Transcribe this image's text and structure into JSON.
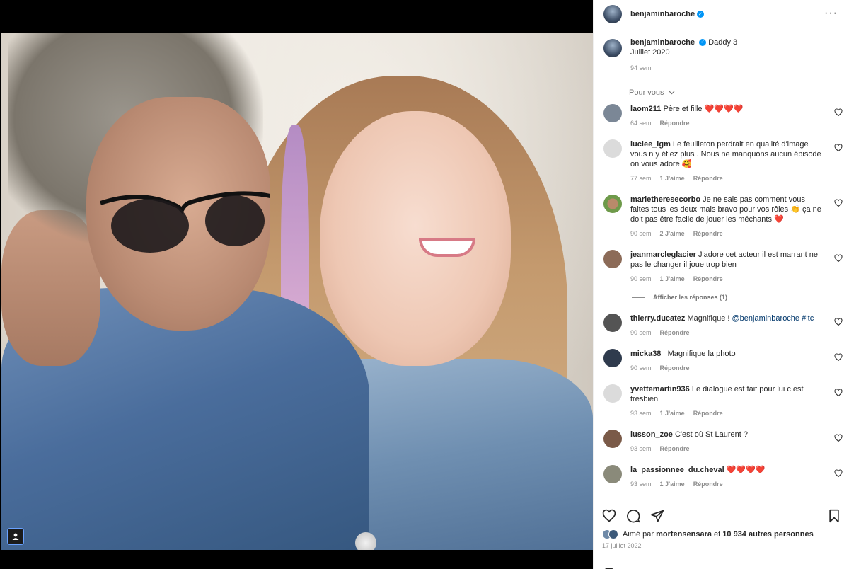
{
  "post": {
    "author": "benjaminbaroche",
    "verified_glyph": "✓",
    "more_glyph": "···",
    "caption_line1": "Daddy 3",
    "caption_line2": "Juillet 2020",
    "caption_age": "94 sem"
  },
  "sort": {
    "label": "Pour vous"
  },
  "comments": [
    {
      "user": "laom211",
      "text": "Père et fille ❤️❤️❤️❤️",
      "age": "64 sem",
      "likes": "",
      "reply": "Répondre",
      "avatar_color": "#7b8796"
    },
    {
      "user": "luciee_lgm",
      "text": "Le feuilleton perdrait en qualité d'image vous n y étiez plus . Nous ne manquons aucun épisode on vous adore 🥰",
      "age": "77 sem",
      "likes": "1 J'aime",
      "reply": "Répondre",
      "avatar_color": "#dbdbdb"
    },
    {
      "user": "marietheresecorbo",
      "text": "Je ne sais pas comment vous faites tous les deux mais bravo pour vos rôles 👏 ça ne doit pas être facile de jouer les méchants ❤️",
      "age": "90 sem",
      "likes": "2 J'aime",
      "reply": "Répondre",
      "avatar_color": "#6e9a4a"
    },
    {
      "user": "jeanmarcleglacier",
      "text": "J'adore cet acteur il est marrant ne pas le changer il joue trop bien",
      "age": "90 sem",
      "likes": "1 J'aime",
      "reply": "Répondre",
      "avatar_color": "#8c6b58"
    },
    {
      "user": "thierry.ducatez",
      "text": "Magnifique ! ",
      "mention": "@benjaminbaroche #itc",
      "age": "90 sem",
      "likes": "",
      "reply": "Répondre",
      "avatar_color": "#545454"
    },
    {
      "user": "micka38_",
      "text": "Magnifique la photo",
      "age": "90 sem",
      "likes": "",
      "reply": "Répondre",
      "avatar_color": "#2f3b4d"
    },
    {
      "user": "yvettemartin936",
      "text": "Le dialogue est fait pour lui c est tresbien",
      "age": "93 sem",
      "likes": "1 J'aime",
      "reply": "Répondre",
      "avatar_color": "#dbdbdb"
    },
    {
      "user": "lusson_zoe",
      "text": "C'est où St Laurent ?",
      "age": "93 sem",
      "likes": "",
      "reply": "Répondre",
      "avatar_color": "#7a5a48"
    },
    {
      "user": "la_passionnee_du.cheval",
      "text": "❤️❤️❤️❤️",
      "age": "93 sem",
      "likes": "1 J'aime",
      "reply": "Répondre",
      "avatar_color": "#8a8a7a"
    }
  ],
  "view_replies": "Afficher les réponses (1)",
  "likes": {
    "prefix": "Aimé par",
    "user": "mortensensara",
    "middle": "et",
    "count": "10 934 autres personnes"
  },
  "date": "17 juillet 2022",
  "colors": {
    "link": "#00376b",
    "verified": "#0095f6",
    "muted": "#8e8e8e"
  },
  "icons": [
    "heart-icon",
    "comment-icon",
    "share-icon",
    "bookmark-icon",
    "more-icon",
    "user-tag-icon",
    "chevron-down-icon"
  ]
}
